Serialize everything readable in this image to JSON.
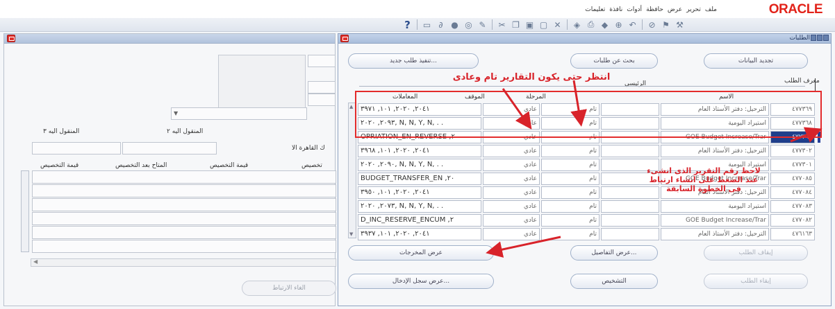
{
  "app": {
    "logo": "ORACLE",
    "menu": [
      "ملف",
      "تحرير",
      "عرض",
      "حافظة",
      "أدوات",
      "نافذة",
      "تعليمات"
    ]
  },
  "toolbar": {
    "icons": [
      "help-icon",
      "folder-icon",
      "attach-icon",
      "globe-icon",
      "search-icon",
      "edit-icon",
      "cut-icon",
      "copy-icon",
      "paste-icon",
      "new-icon",
      "delete-icon",
      "translate-icon",
      "print-icon",
      "save-icon",
      "zoom-icon",
      "undo-icon",
      "forbid-icon",
      "flag-icon",
      "tools-icon"
    ]
  },
  "back_window": {
    "columns": [
      "المنقول اليه ٣",
      "المنقول اليه ٢"
    ],
    "mid_label": "ك القاهرة الا",
    "alloc_headers": [
      "قيمة التخصيص",
      "المتاح بعد التخصيص",
      "قيمة التخصيص",
      "تخصيص"
    ],
    "cancel_link_button": "الغاء الارتباط"
  },
  "requests_window": {
    "title": "الطلبات",
    "buttons": {
      "refresh": "تجديد البيانات",
      "find": "بحث عن طلبات",
      "submit_new": "تنفيذ طلب جديد...",
      "cancel_request": "إيقاف الطلب",
      "view_details": "عرض التفاصيل...",
      "view_output": "عرض المخرجات",
      "hold": "إيقاء الطلب",
      "diagnostics": "التشخيص",
      "view_log": "عرض سجل الإدخال..."
    },
    "labels": {
      "request_id": "معرف الطلب",
      "parent": "الرئيسي",
      "name": "الاسم",
      "phase": "المرحلة",
      "status": "الموقف",
      "parameters": "المعاملات"
    },
    "rows": [
      {
        "id": "٤٧٧٣٦٩",
        "name": "الترحيل: دفتر الأستاذ العام",
        "phase": "تام",
        "status": "عادي",
        "params": "٢٠٤١, ٢٠٢٠, ١٠١, ٣٩٧١"
      },
      {
        "id": "٤٧٧٣٦٨",
        "name": "استيراد اليومية",
        "phase": "تام",
        "status": "عادي",
        "params": "٢٠٩٣, ٢٠٢٠, N, N, Y, N, . ."
      },
      {
        "id": "٤٧٧٣٦٧",
        "name": "GOE Budget Increase/Trar",
        "phase": "تام",
        "status": "عادي",
        "params": "OPRIATION_EN_REVERSE ,٢",
        "selected": true
      },
      {
        "id": "٤٧٧٣٠٢",
        "name": "الترحيل: دفتر الأستاذ العام",
        "phase": "تام",
        "status": "عادي",
        "params": "٢٠٤١, ٢٠٢٠, ١٠١, ٣٩٦٨"
      },
      {
        "id": "٤٧٧٣٠١",
        "name": "استيراد اليومية",
        "phase": "تام",
        "status": "عادي",
        "params": "٢٠٩٠, ٢٠٢٠, N, N, Y, N, . ."
      },
      {
        "id": "٤٧٧٠٨٥",
        "name": "GOE Budget Increase/Trar",
        "phase": "تام",
        "status": "عادي",
        "params": "BUDGET_TRANSFER_EN ,٢٠"
      },
      {
        "id": "٤٧٧٠٨٤",
        "name": "الترحيل: دفتر الأستاذ العام",
        "phase": "تام",
        "status": "عادي",
        "params": "٢٠٤١, ٢٠٢٠, ١٠١, ٣٩٥٠"
      },
      {
        "id": "٤٧٧٠٨٣",
        "name": "استيراد اليومية",
        "phase": "تام",
        "status": "عادي",
        "params": "٢٠٧٣, ٢٠٢٠, N, N, Y, N, . ."
      },
      {
        "id": "٤٧٧٠٨٢",
        "name": "GOE Budget Increase/Trar",
        "phase": "تام",
        "status": "عادي",
        "params": "D_INC_RESERVE_ENCUM ,٢"
      },
      {
        "id": "٤٧٦١٦٣",
        "name": "الترحيل: دفتر الأستاذ العام",
        "phase": "تام",
        "status": "عادي",
        "params": "٢٠٤١, ٢٠٢٠, ١٠١, ٣٩٣٧"
      }
    ]
  },
  "annotations": {
    "wait_note": "انتظر حتى يكون التقارير تام وعادى",
    "number_note_line1": "لاحظ رقم التقرير الذى انشىء",
    "number_note_line2": "عند الضغط على انشاء ارتباط",
    "number_note_line3": "فى الخطوة السابقة"
  },
  "colors": {
    "oracle_red": "#e2231a",
    "annotation_red": "#d8232a",
    "selection_blue": "#1f3f8b",
    "title_blue": "#b2c3dd"
  }
}
